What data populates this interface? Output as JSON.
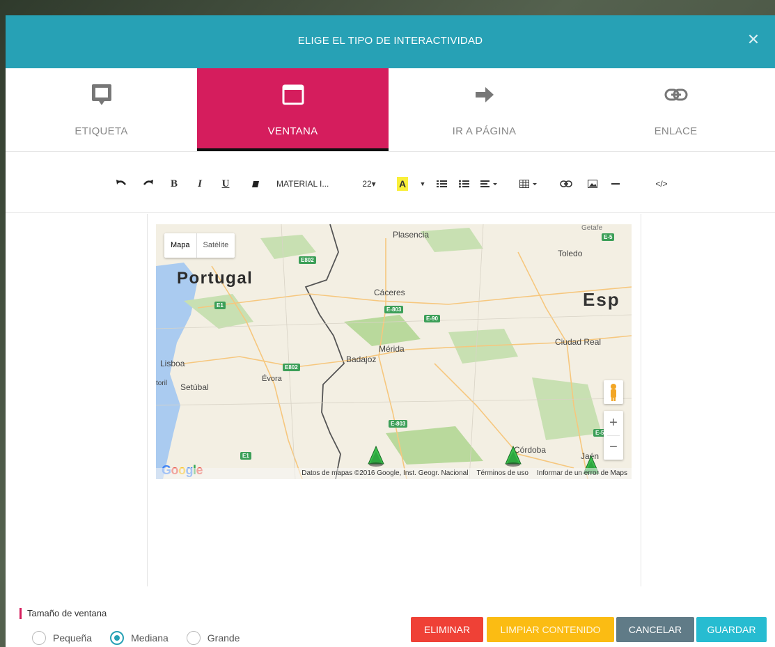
{
  "dialog": {
    "title": "ELIGE EL TIPO DE INTERACTIVIDAD",
    "close_icon": "close-icon"
  },
  "tabs": [
    {
      "label": "ETIQUETA",
      "icon": "label-icon",
      "active": false
    },
    {
      "label": "VENTANA",
      "icon": "window-icon",
      "active": true
    },
    {
      "label": "IR A PÁGINA",
      "icon": "arrow-right-icon",
      "active": false
    },
    {
      "label": "ENLACE",
      "icon": "link-icon",
      "active": false
    }
  ],
  "toolbar": {
    "font_name": "MATERIAL I...",
    "font_size": "22▾",
    "code_label": "</>"
  },
  "map": {
    "type_buttons": [
      "Mapa",
      "Satélite"
    ],
    "selected_type": "Mapa",
    "labels": {
      "portugal": "Portugal",
      "espana": "Esp",
      "plasencia": "Plasencia",
      "toledo": "Toledo",
      "getafe": "Getafe",
      "caceres": "Cáceres",
      "merida": "Mérida",
      "badajoz": "Badajoz",
      "ciudad_real": "Ciudad Real",
      "lisboa": "Lisboa",
      "estoril": "toril",
      "setubal": "Setúbal",
      "evora": "Évora",
      "cordoba": "Córdoba",
      "jaen": "Jaén"
    },
    "shields": [
      "E802",
      "E-5",
      "E1",
      "E-803",
      "E-90",
      "E802",
      "E-803",
      "E1",
      "E-5"
    ],
    "zoom_in": "+",
    "zoom_out": "−",
    "logo": "Google",
    "attribution": "Datos de mapas ©2016 Google, Inst. Geogr. Nacional",
    "terms": "Términos de uso",
    "report": "Informar de un error de Maps"
  },
  "window_size": {
    "label": "Tamaño de ventana",
    "options": [
      "Pequeña",
      "Mediana",
      "Grande"
    ],
    "selected": "Mediana"
  },
  "actions": {
    "delete": "ELIMINAR",
    "clear": "LIMPIAR CONTENIDO",
    "cancel": "CANCELAR",
    "save": "GUARDAR"
  },
  "colors": {
    "header": "#27a1b5",
    "active_tab": "#d51d5d",
    "delete": "#ef4136",
    "clear": "#fbbc13",
    "cancel": "#607b87",
    "save": "#27bcd1"
  }
}
